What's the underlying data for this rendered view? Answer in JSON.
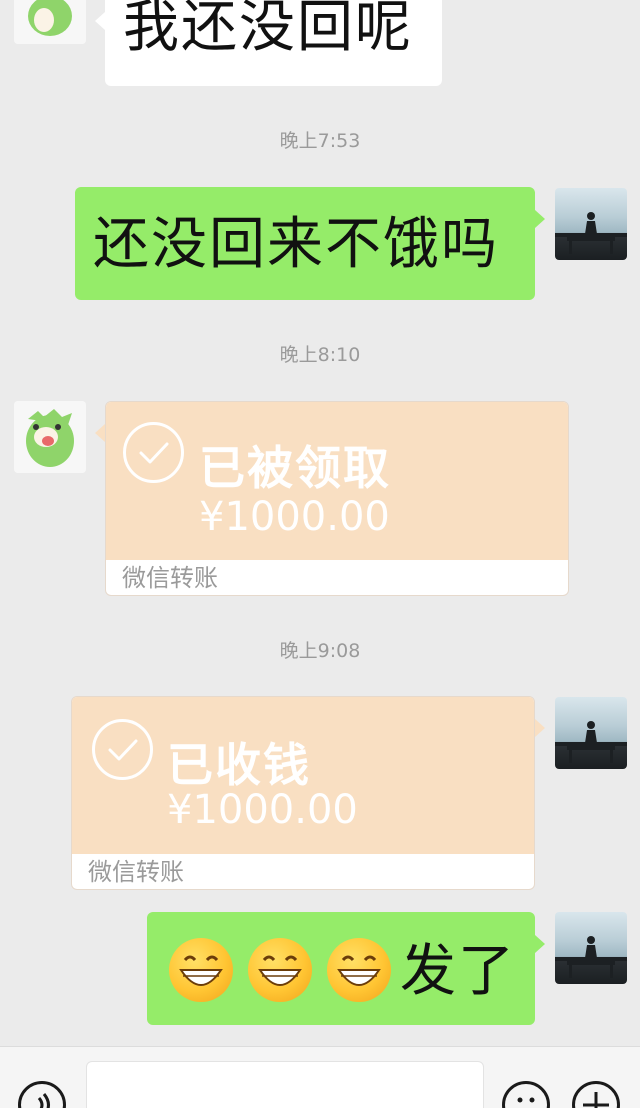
{
  "messages": {
    "m1_text": "我还没回呢",
    "t1": "晚上7:53",
    "m2_text": "还没回来不饿吗",
    "t2": "晚上8:10",
    "transfer1": {
      "title": "已被领取",
      "amount": "¥1000.00",
      "label": "微信转账"
    },
    "t3": "晚上9:08",
    "transfer2": {
      "title": "已收钱",
      "amount": "¥1000.00",
      "label": "微信转账"
    },
    "m5_suffix": "发了"
  },
  "icons": {
    "voice": "voice-icon",
    "emoji_button": "emoji-icon",
    "plus": "plus-icon",
    "check": "check-circle-icon",
    "grin": "grinning-face-emoji"
  },
  "colors": {
    "background": "#ebebeb",
    "self_bubble": "#95ec69",
    "other_bubble": "#ffffff",
    "transfer": "#f9dfc2"
  }
}
